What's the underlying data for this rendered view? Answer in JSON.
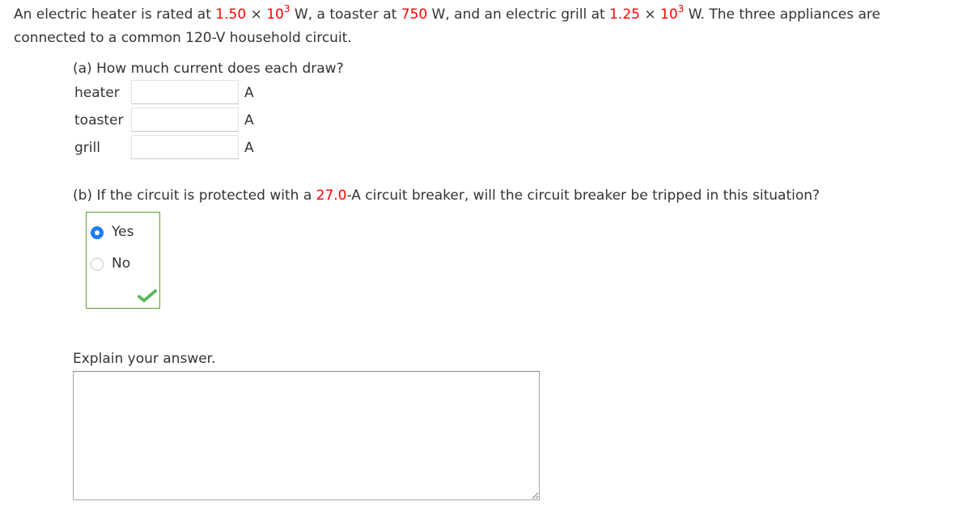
{
  "problem": {
    "intro_1": "An electric heater is rated at ",
    "heater_power_mantissa": "1.50",
    "times": "×",
    "heater_power_base": "10",
    "heater_power_exp": "3",
    "intro_2": " W, a toaster at ",
    "toaster_power": "750",
    "intro_3": " W, and an electric grill at ",
    "grill_power_mantissa": "1.25",
    "grill_power_base": "10",
    "grill_power_exp": "3",
    "intro_4": " W. The three appliances are",
    "intro_line2": "connected to a common 120-V household circuit."
  },
  "part_a": {
    "question": "(a) How much current does each draw?",
    "rows": [
      {
        "label": "heater",
        "value": "",
        "unit": "A"
      },
      {
        "label": "toaster",
        "value": "",
        "unit": "A"
      },
      {
        "label": "grill",
        "value": "",
        "unit": "A"
      }
    ]
  },
  "part_b": {
    "question_1": "(b) If the circuit is protected with a ",
    "breaker_rating": "27.0",
    "question_2": "-A circuit breaker, will the circuit breaker be tripped in this situation?",
    "options": [
      {
        "label": "Yes",
        "selected": true
      },
      {
        "label": "No",
        "selected": false
      }
    ],
    "status": "correct"
  },
  "explain": {
    "label": "Explain your answer.",
    "value": ""
  },
  "colors": {
    "highlight": "#ff0000",
    "correct_border": "#5aa02c",
    "radio_selected": "#1e7ef2",
    "checkmark": "#5cb85c"
  }
}
